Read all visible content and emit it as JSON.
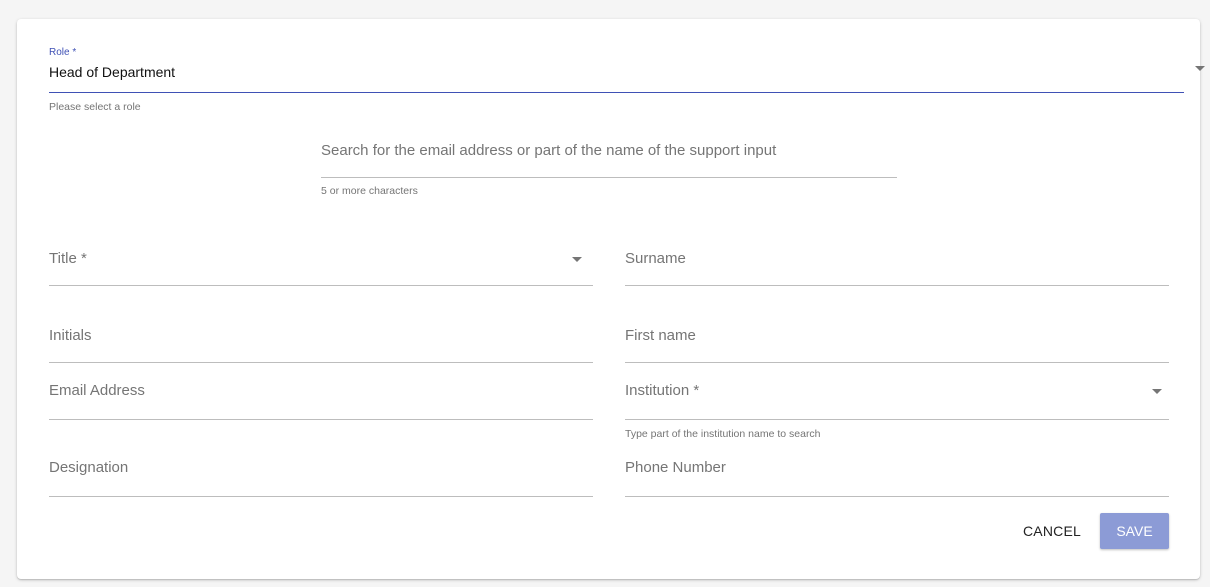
{
  "role": {
    "label": "Role *",
    "value": "Head of Department",
    "helper": "Please select a role"
  },
  "search": {
    "placeholder": "Search for the email address or part of the name of the support input",
    "helper": "5 or more characters"
  },
  "fields": {
    "title": "Title *",
    "surname": "Surname",
    "initials": "Initials",
    "first_name": "First name",
    "email": "Email Address",
    "institution": "Institution *",
    "institution_helper": "Type part of the institution name to search",
    "designation": "Designation",
    "phone": "Phone Number"
  },
  "actions": {
    "cancel": "CANCEL",
    "save": "SAVE"
  },
  "colors": {
    "accent": "#3f51b5",
    "save_button": "#8c9bd6"
  },
  "icons": {
    "dropdown": "chevron-down-icon"
  }
}
